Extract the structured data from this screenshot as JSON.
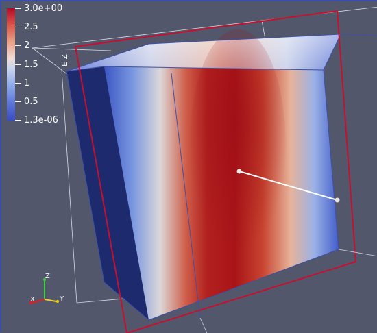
{
  "colorbar": {
    "title": "E Z",
    "labels": [
      "3.0e+00",
      "2.5",
      "2",
      "1.5",
      "1",
      "0.5",
      "1.3e-06"
    ]
  },
  "orientation_axes": {
    "x": "X",
    "y": "Y",
    "z": "Z"
  },
  "colors": {
    "background": "#52576b",
    "colormap_high": "#b40b26",
    "colormap_mid": "#dddddd",
    "colormap_low": "#3b4cc0",
    "clip_plane_outline": "#c8102e",
    "bounds_outline": "#3c50a8",
    "probe_line": "#ffffff"
  }
}
